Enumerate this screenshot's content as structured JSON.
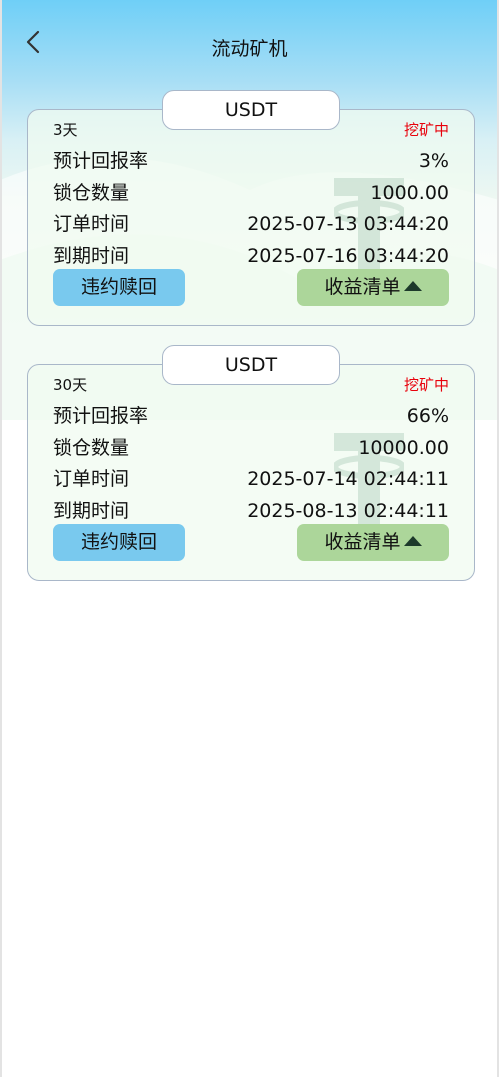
{
  "header": {
    "title": "流动矿机",
    "back_icon": "chevron-left-icon"
  },
  "orders": [
    {
      "coin": "USDT",
      "duration": "3天",
      "status": "挖矿中",
      "rate_label": "预计回报率",
      "rate_value": "3%",
      "amount_label": "锁仓数量",
      "amount_value": "1000.00",
      "order_time_label": "订单时间",
      "order_time_value": "2025-07-13 03:44:20",
      "expire_time_label": "到期时间",
      "expire_time_value": "2025-07-16 03:44:20",
      "redeem_label": "违约赎回",
      "earnings_label": "收益清单"
    },
    {
      "coin": "USDT",
      "duration": "30天",
      "status": "挖矿中",
      "rate_label": "预计回报率",
      "rate_value": "66%",
      "amount_label": "锁仓数量",
      "amount_value": "10000.00",
      "order_time_label": "订单时间",
      "order_time_value": "2025-07-14 02:44:11",
      "expire_time_label": "到期时间",
      "expire_time_value": "2025-08-13 02:44:11",
      "redeem_label": "违约赎回",
      "earnings_label": "收益清单"
    }
  ],
  "colors": {
    "status": "#e8000b",
    "redeem_button": "#79c9ee",
    "earnings_button": "#acd69a",
    "header_top": "#6fcff7"
  }
}
